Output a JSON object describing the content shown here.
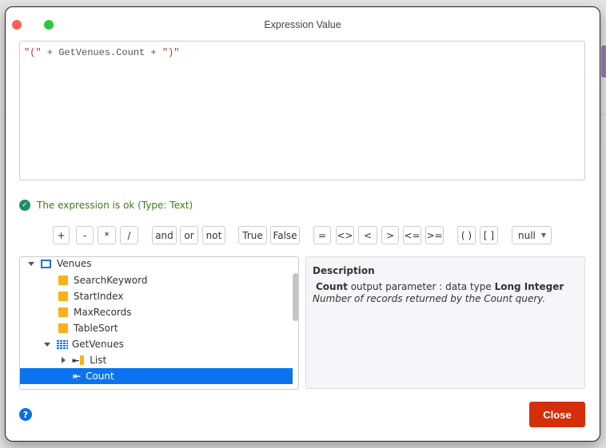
{
  "window": {
    "title": "Expression Value"
  },
  "editor": {
    "part1": "\"(\"",
    "part2": " + GetVenues.Count + ",
    "part3": "\")\""
  },
  "status": {
    "text": "The expression is ok (Type: Text)"
  },
  "operators": [
    "+",
    "-",
    "*",
    "/",
    "and",
    "or",
    "not",
    "True",
    "False",
    "=",
    "<>",
    "<",
    ">",
    "<=",
    ">=",
    "( )",
    "[ ]"
  ],
  "null_select": {
    "value": "null"
  },
  "tree": {
    "items": [
      {
        "label": "Venues"
      },
      {
        "label": "SearchKeyword"
      },
      {
        "label": "StartIndex"
      },
      {
        "label": "MaxRecords"
      },
      {
        "label": "TableSort"
      },
      {
        "label": "GetVenues"
      },
      {
        "label": "List"
      },
      {
        "label": "Count"
      }
    ]
  },
  "description": {
    "heading": "Description",
    "name": "Count",
    "middle": " output parameter : data type ",
    "type": "Long Integer",
    "detail": "Number of records returned by the Count query."
  },
  "footer": {
    "help": "?",
    "close_label": "Close"
  }
}
